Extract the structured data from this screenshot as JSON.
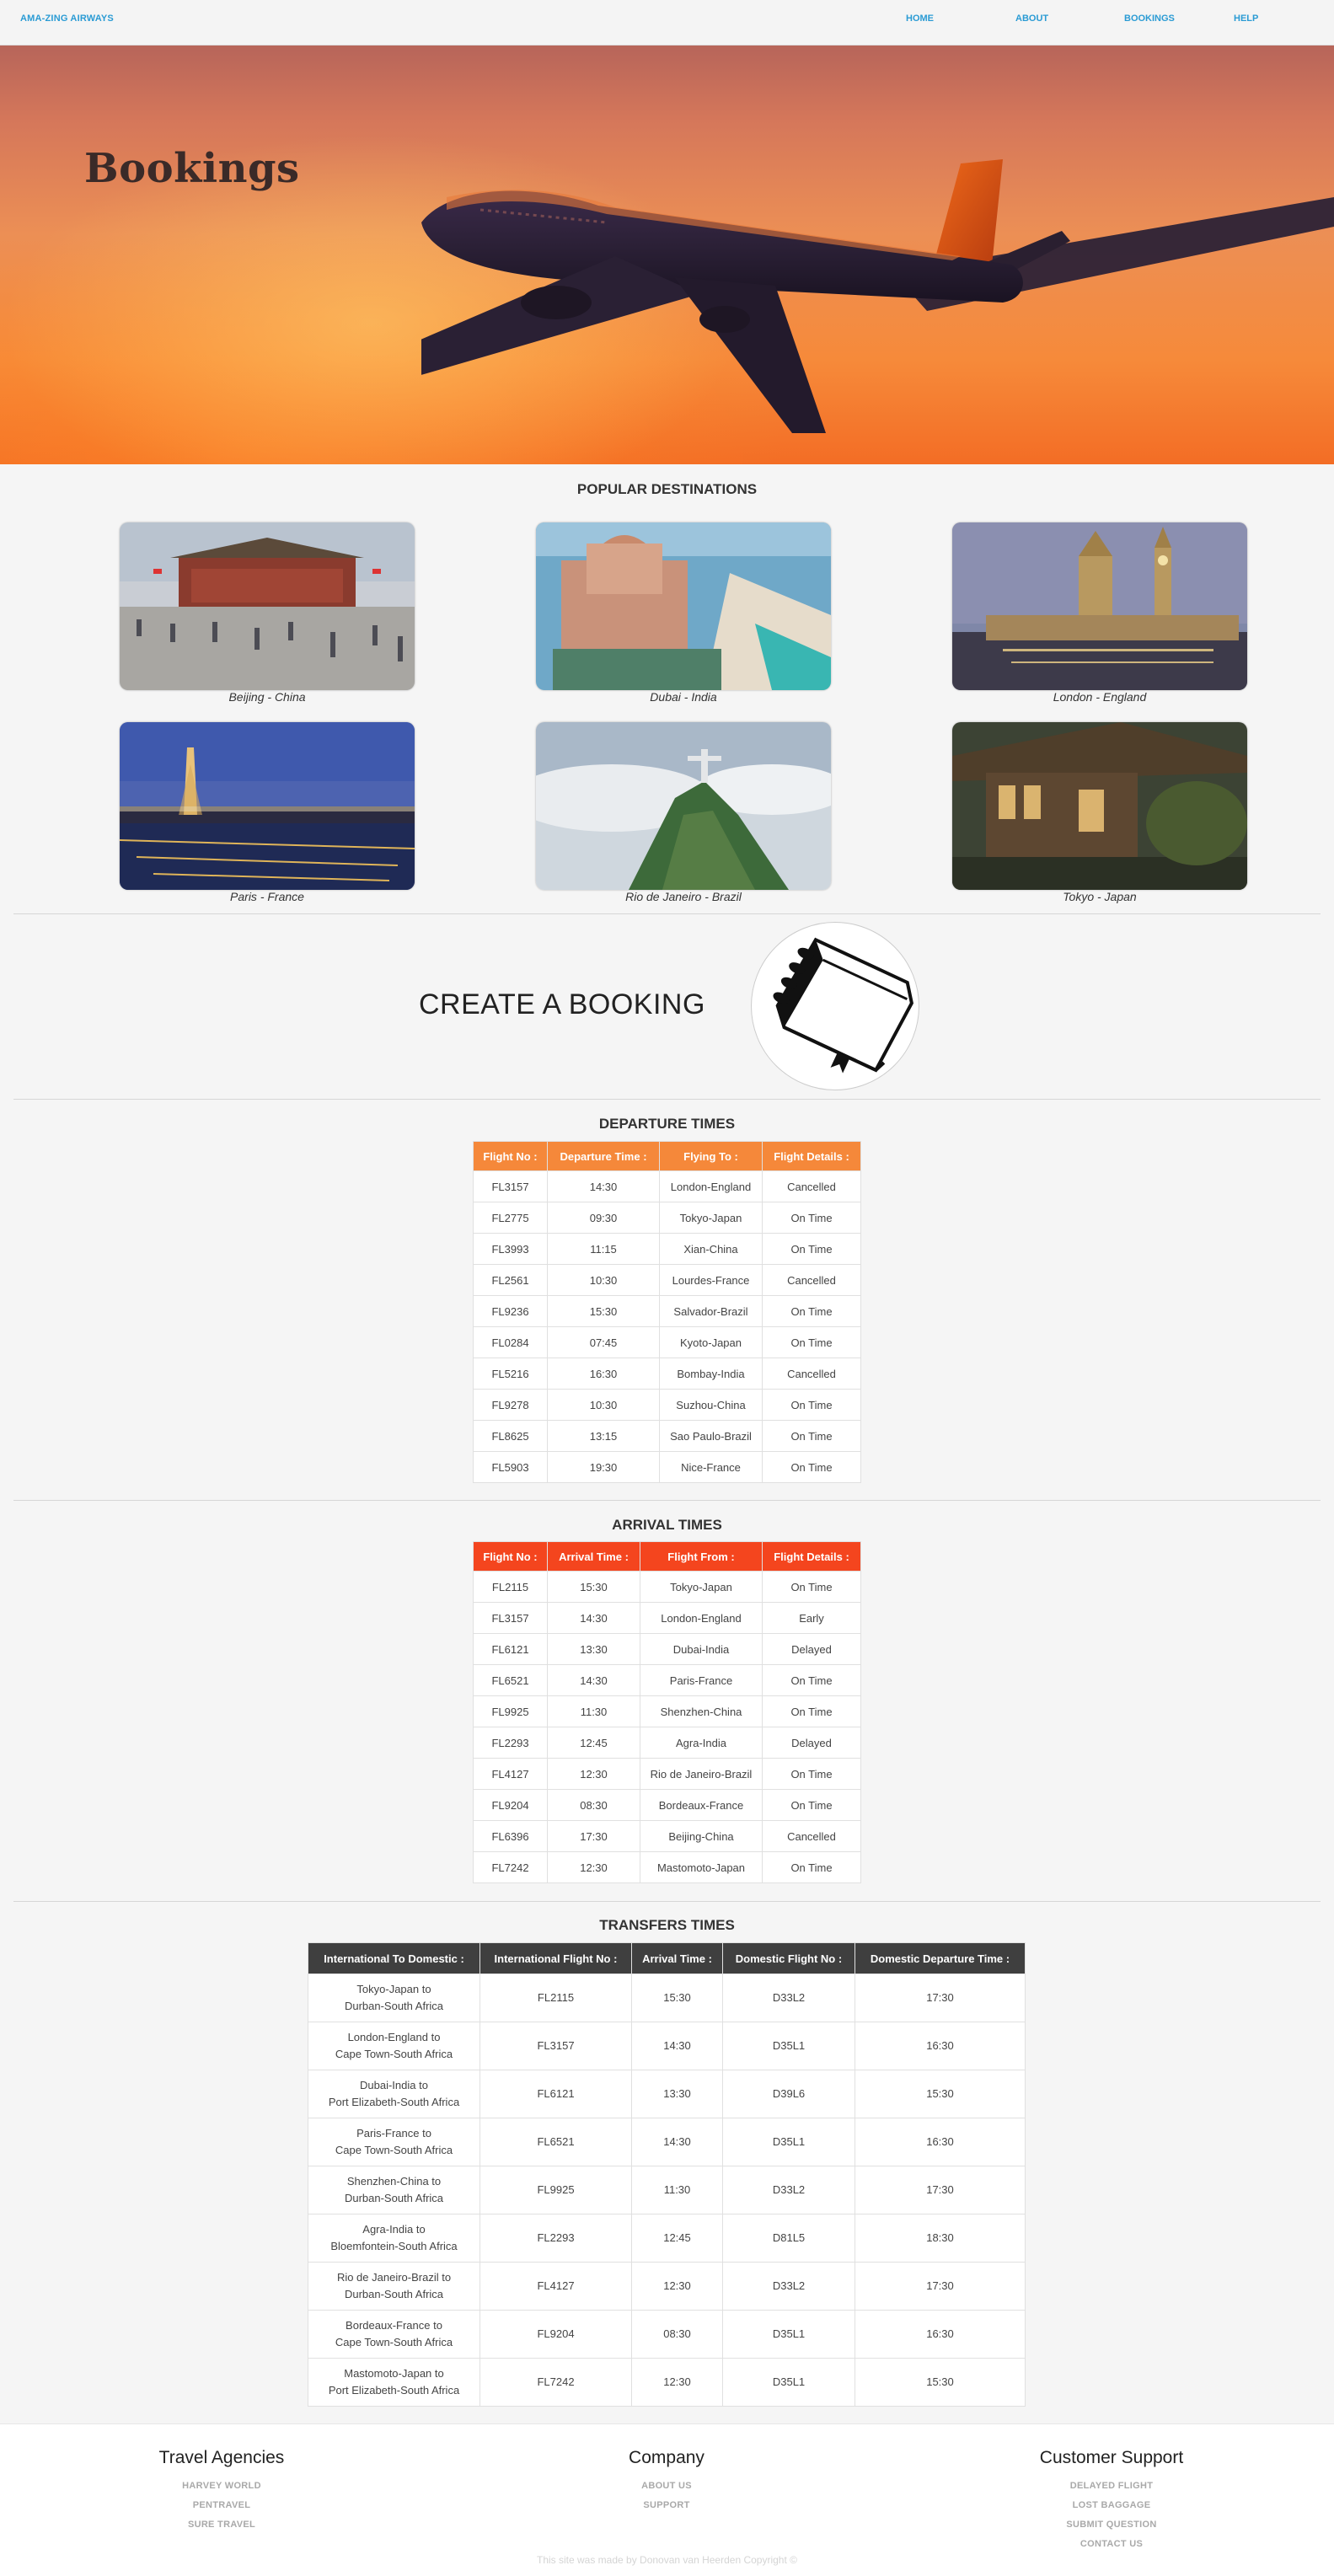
{
  "nav": {
    "brand": "AMA-ZING AIRWAYS",
    "links": [
      "HOME",
      "ABOUT",
      "BOOKINGS",
      "HELP"
    ]
  },
  "hero": {
    "title": "Bookings"
  },
  "destinations": {
    "title": "POPULAR DESTINATIONS",
    "items": [
      "Beijing - China",
      "Dubai - India",
      "London - England",
      "Paris - France",
      "Rio de Janeiro - Brazil",
      "Tokyo - Japan"
    ]
  },
  "create": {
    "label": "CREATE A BOOKING",
    "icon": "book-icon"
  },
  "departures": {
    "title": "DEPARTURE TIMES",
    "headers": [
      "Flight No :",
      "Departure Time :",
      "Flying To :",
      "Flight Details :"
    ],
    "rows": [
      [
        "FL3157",
        "14:30",
        "London-England",
        "Cancelled"
      ],
      [
        "FL2775",
        "09:30",
        "Tokyo-Japan",
        "On Time"
      ],
      [
        "FL3993",
        "11:15",
        "Xian-China",
        "On Time"
      ],
      [
        "FL2561",
        "10:30",
        "Lourdes-France",
        "Cancelled"
      ],
      [
        "FL9236",
        "15:30",
        "Salvador-Brazil",
        "On Time"
      ],
      [
        "FL0284",
        "07:45",
        "Kyoto-Japan",
        "On Time"
      ],
      [
        "FL5216",
        "16:30",
        "Bombay-India",
        "Cancelled"
      ],
      [
        "FL9278",
        "10:30",
        "Suzhou-China",
        "On Time"
      ],
      [
        "FL8625",
        "13:15",
        "Sao Paulo-Brazil",
        "On Time"
      ],
      [
        "FL5903",
        "19:30",
        "Nice-France",
        "On Time"
      ]
    ]
  },
  "arrivals": {
    "title": "ARRIVAL TIMES",
    "headers": [
      "Flight No :",
      "Arrival Time :",
      "Flight From :",
      "Flight Details :"
    ],
    "rows": [
      [
        "FL2115",
        "15:30",
        "Tokyo-Japan",
        "On Time"
      ],
      [
        "FL3157",
        "14:30",
        "London-England",
        "Early"
      ],
      [
        "FL6121",
        "13:30",
        "Dubai-India",
        "Delayed"
      ],
      [
        "FL6521",
        "14:30",
        "Paris-France",
        "On Time"
      ],
      [
        "FL9925",
        "11:30",
        "Shenzhen-China",
        "On Time"
      ],
      [
        "FL2293",
        "12:45",
        "Agra-India",
        "Delayed"
      ],
      [
        "FL4127",
        "12:30",
        "Rio de Janeiro-Brazil",
        "On Time"
      ],
      [
        "FL9204",
        "08:30",
        "Bordeaux-France",
        "On Time"
      ],
      [
        "FL6396",
        "17:30",
        "Beijing-China",
        "Cancelled"
      ],
      [
        "FL7242",
        "12:30",
        "Mastomoto-Japan",
        "On Time"
      ]
    ]
  },
  "transfers": {
    "title": "TRANSFERS TIMES",
    "headers": [
      "International To Domestic :",
      "International Flight No :",
      "Arrival Time :",
      "Domestic Flight No :",
      "Domestic Departure Time :"
    ],
    "rows": [
      [
        [
          "Tokyo-Japan to",
          "Durban-South Africa"
        ],
        "FL2115",
        "15:30",
        "D33L2",
        "17:30"
      ],
      [
        [
          "London-England to",
          "Cape Town-South Africa"
        ],
        "FL3157",
        "14:30",
        "D35L1",
        "16:30"
      ],
      [
        [
          "Dubai-India to",
          "Port Elizabeth-South Africa"
        ],
        "FL6121",
        "13:30",
        "D39L6",
        "15:30"
      ],
      [
        [
          "Paris-France to",
          "Cape Town-South Africa"
        ],
        "FL6521",
        "14:30",
        "D35L1",
        "16:30"
      ],
      [
        [
          "Shenzhen-China to",
          "Durban-South Africa"
        ],
        "FL9925",
        "11:30",
        "D33L2",
        "17:30"
      ],
      [
        [
          "Agra-India to",
          "Bloemfontein-South Africa"
        ],
        "FL2293",
        "12:45",
        "D81L5",
        "18:30"
      ],
      [
        [
          "Rio de Janeiro-Brazil to",
          "Durban-South Africa"
        ],
        "FL4127",
        "12:30",
        "D33L2",
        "17:30"
      ],
      [
        [
          "Bordeaux-France to",
          "Cape Town-South Africa"
        ],
        "FL9204",
        "08:30",
        "D35L1",
        "16:30"
      ],
      [
        [
          "Mastomoto-Japan to",
          "Port Elizabeth-South Africa"
        ],
        "FL7242",
        "12:30",
        "D35L1",
        "15:30"
      ]
    ]
  },
  "footer": {
    "columns": [
      {
        "heading": "Travel Agencies",
        "links": [
          "HARVEY WORLD",
          "PENTRAVEL",
          "SURE TRAVEL"
        ]
      },
      {
        "heading": "Company",
        "links": [
          "ABOUT US",
          "SUPPORT"
        ]
      },
      {
        "heading": "Customer Support",
        "links": [
          "DELAYED FLIGHT",
          "LOST BAGGAGE",
          "SUBMIT QUESTION",
          "CONTACT US"
        ]
      }
    ],
    "copyright": "This site was made by Donovan van Heerden Copyright ©"
  }
}
